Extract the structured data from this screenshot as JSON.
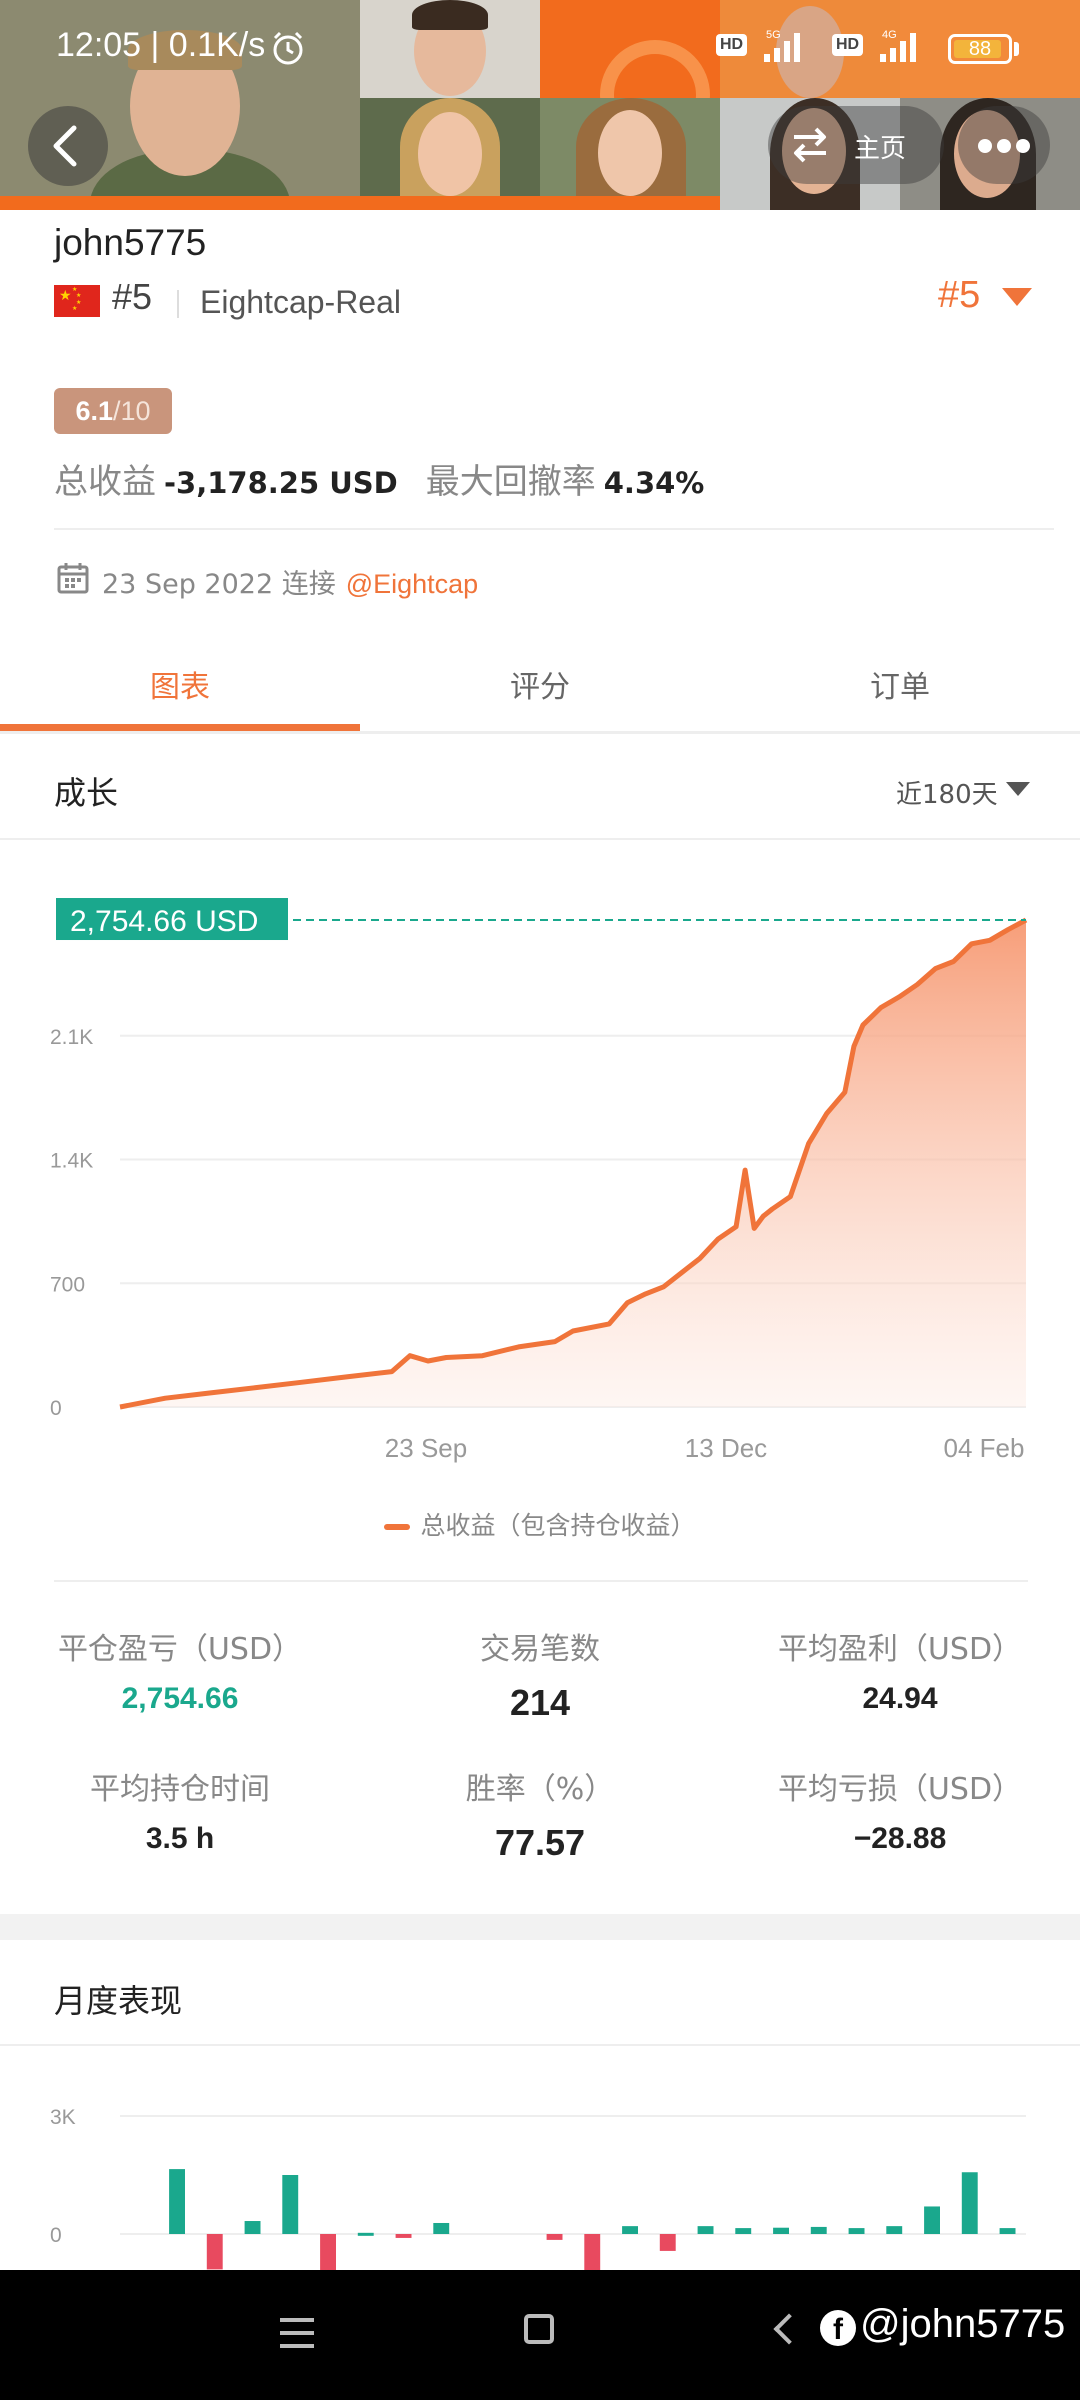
{
  "status_bar": {
    "time": "12:05 | 0.1K/s",
    "net_5g": "5G",
    "net_4g": "4G",
    "hd": "HD",
    "battery": "88"
  },
  "header": {
    "home_label": "主页"
  },
  "profile": {
    "username": "john5775",
    "rank": "#5",
    "broker": "Eightcap-Real",
    "rank_right": "#5",
    "score": "6.1",
    "score_max": "/10",
    "total_profit_label": "总收益",
    "total_profit_value": "-3,178.25 USD",
    "max_drawdown_label": "最大回撤率",
    "max_drawdown_value": "4.34%",
    "connected_date": "23 Sep 2022 连接",
    "connected_link": "@Eightcap"
  },
  "tabs": [
    {
      "label": "图表",
      "active": true
    },
    {
      "label": "评分",
      "active": false
    },
    {
      "label": "订单",
      "active": false
    }
  ],
  "growth": {
    "title": "成长",
    "range": "近180天",
    "current_value_tag": "2,754.66 USD",
    "legend": "总收益（包含持仓收益）"
  },
  "chart_data": [
    {
      "type": "area",
      "title": "",
      "ylabel": "",
      "xlabel": "",
      "y_ticks": [
        0,
        700,
        1400,
        2100
      ],
      "y_tick_labels": [
        "0",
        "700",
        "1.4K",
        "2.1K"
      ],
      "x_tick_labels": [
        "23 Sep",
        "13 Dec",
        "04 Feb"
      ],
      "ylim": [
        0,
        2800
      ],
      "x_index_range": [
        0,
        100
      ],
      "series": [
        {
          "name": "总收益（包含持仓收益）",
          "color": "#f0743a",
          "x": [
            0,
            5,
            10,
            15,
            20,
            25,
            30,
            32,
            34,
            36,
            40,
            44,
            48,
            50,
            54,
            56,
            58,
            60,
            62,
            64,
            66,
            68,
            69,
            70,
            71,
            72,
            74,
            76,
            78,
            80,
            81,
            82,
            84,
            86,
            88,
            90,
            92,
            94,
            96,
            98,
            100
          ],
          "values": [
            0,
            50,
            80,
            110,
            140,
            170,
            200,
            290,
            260,
            280,
            290,
            340,
            370,
            430,
            470,
            590,
            640,
            680,
            760,
            840,
            950,
            1020,
            1340,
            1010,
            1080,
            1120,
            1190,
            1490,
            1660,
            1780,
            2040,
            2160,
            2260,
            2320,
            2390,
            2480,
            2520,
            2620,
            2640,
            2700,
            2754.66
          ]
        }
      ]
    },
    {
      "type": "bar",
      "title": "",
      "y_tick_labels": [
        "0",
        "3K"
      ],
      "ylim": [
        -1000,
        3000
      ],
      "series": [
        {
          "name": "",
          "positive_color": "#1aa88d",
          "negative_color": "#e84a5f",
          "values": [
            0,
            1650,
            -900,
            330,
            1500,
            -950,
            30,
            -100,
            280,
            0,
            0,
            -150,
            -1050,
            200,
            -430,
            200,
            150,
            160,
            180,
            150,
            200,
            700,
            1570,
            150
          ]
        }
      ]
    }
  ],
  "metrics": [
    {
      "label": "平仓盈亏（USD）",
      "value": "2,754.66",
      "style": "green"
    },
    {
      "label": "交易笔数",
      "value": "214",
      "style": "big"
    },
    {
      "label": "平均盈利（USD）",
      "value": "24.94",
      "style": "normal"
    },
    {
      "label": "平均持仓时间",
      "value": "3.5 h",
      "style": "normal"
    },
    {
      "label": "胜率（%）",
      "value": "77.57",
      "style": "big"
    },
    {
      "label": "平均亏损（USD）",
      "value": "−28.88",
      "style": "normal"
    }
  ],
  "monthly": {
    "title": "月度表现"
  },
  "nav": {
    "watermark": "@john5775"
  },
  "colors": {
    "accent": "#f0743a",
    "green": "#1aa88d",
    "red": "#e84a5f"
  }
}
